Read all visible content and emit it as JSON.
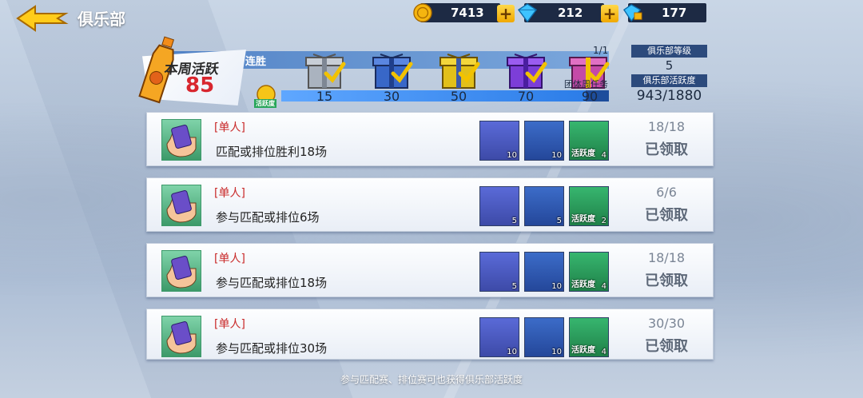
{
  "header": {
    "title": "俱乐部"
  },
  "resources": [
    {
      "name": "gold-coin",
      "value": "7413"
    },
    {
      "name": "blue-diamond",
      "value": "212"
    },
    {
      "name": "locked-diamond",
      "value": "177"
    }
  ],
  "activity": {
    "label": "本周活跃",
    "value": "85",
    "strip_text": "连胜",
    "coin_label": "活跃度",
    "progress_fraction": 0.93,
    "milestones": [
      "15",
      "30",
      "50",
      "70",
      "90"
    ],
    "team_task_label": "团体周任务",
    "team_task_count": "1/1"
  },
  "club": {
    "level_label": "俱乐部等级",
    "level_value": "5",
    "activity_label": "俱乐部活跃度",
    "activity_value": "943/1880"
  },
  "tasks": [
    {
      "tag": "[单人]",
      "name": "匹配或排位胜利18场",
      "rewards": [
        {
          "type": "ticket",
          "count": "10"
        },
        {
          "type": "coin",
          "count": "10"
        },
        {
          "type": "activity",
          "count": "4"
        }
      ],
      "progress": "18/18",
      "status": "已领取"
    },
    {
      "tag": "[单人]",
      "name": "参与匹配或排位6场",
      "rewards": [
        {
          "type": "ticket",
          "count": "5"
        },
        {
          "type": "coin",
          "count": "5"
        },
        {
          "type": "activity",
          "count": "2"
        }
      ],
      "progress": "6/6",
      "status": "已领取"
    },
    {
      "tag": "[单人]",
      "name": "参与匹配或排位18场",
      "rewards": [
        {
          "type": "ticket",
          "count": "5"
        },
        {
          "type": "coin",
          "count": "10"
        },
        {
          "type": "activity",
          "count": "4"
        }
      ],
      "progress": "18/18",
      "status": "已领取"
    },
    {
      "tag": "[单人]",
      "name": "参与匹配或排位30场",
      "rewards": [
        {
          "type": "ticket",
          "count": "10"
        },
        {
          "type": "coin",
          "count": "10"
        },
        {
          "type": "activity",
          "count": "4"
        }
      ],
      "progress": "30/30",
      "status": "已领取"
    }
  ],
  "reward_activity_label": "活跃度",
  "footer": "参与匹配赛、排位赛可也获得俱乐部活跃度"
}
